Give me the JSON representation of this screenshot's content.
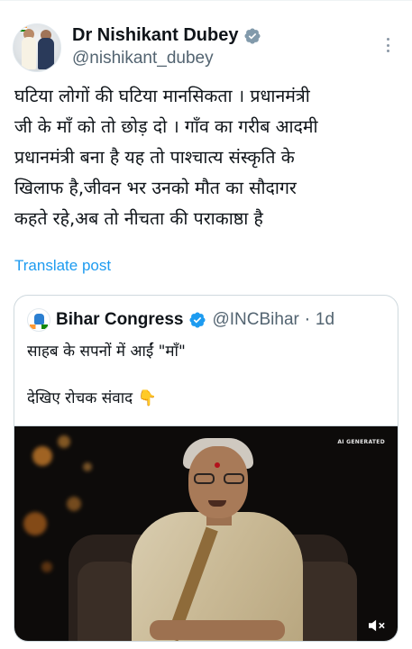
{
  "tweet": {
    "author": {
      "display_name": "Dr Nishikant Dubey",
      "handle": "@nishikant_dubey",
      "verified": true
    },
    "text_lines": [
      "घटिया लोगों की घटिया मानसिकता । प्रधानमंत्री",
      "जी के माँ को तो छोड़ दो । गाँव का गरीब आदमी",
      "प्रधानमंत्री बना है यह तो पाश्चात्य संस्कृति के",
      "खिलाफ है,जीवन भर उनको मौत का सौदागर",
      "कहते रहे,अब तो नीचता की पराकाष्ठा है"
    ],
    "translate_label": "Translate post"
  },
  "quote": {
    "display_name": "Bihar Congress",
    "handle": "@INCBihar",
    "separator": "·",
    "time": "1d",
    "line1": "साहब के सपनों में आईं \"माँ\"",
    "line2": "देखिए रोचक संवाद",
    "emoji": "👇",
    "media_tag": "AI GENERATED"
  },
  "icons": {
    "verified": "verified-badge-icon",
    "more": "more-options-icon",
    "mute": "volume-muted-icon"
  },
  "colors": {
    "accent": "#1d9bf0",
    "text": "#0f1419",
    "secondary": "#536471",
    "border": "#cfd9de"
  }
}
